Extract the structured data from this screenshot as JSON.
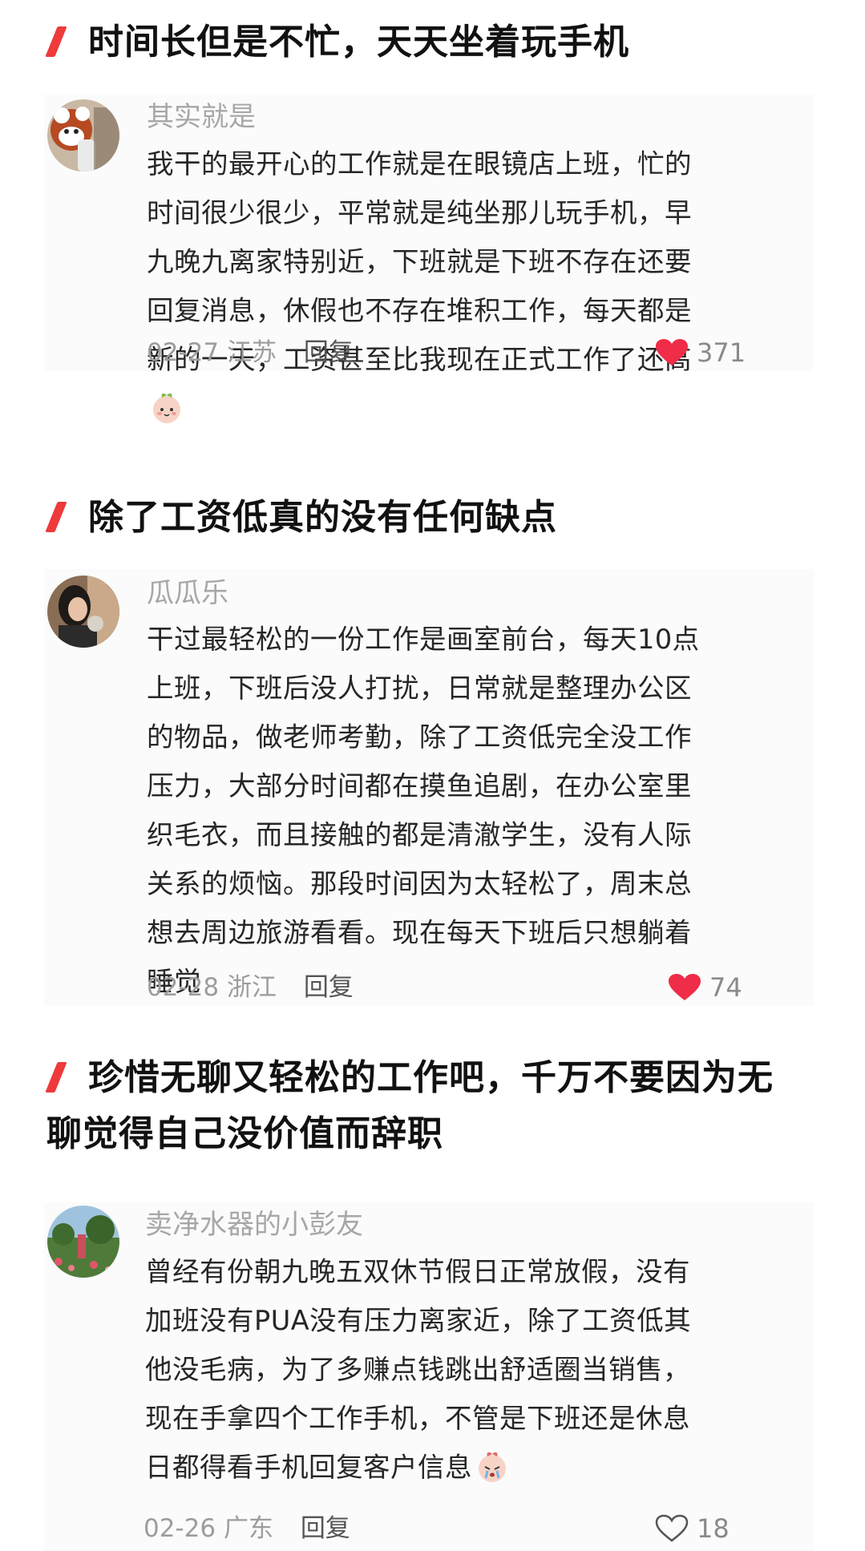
{
  "posts": [
    {
      "heading": "时间长但是不忙，天天坐着玩手机",
      "username": "其实就是",
      "avatar_icon": "red-panda-avatar",
      "comment": "我干的最开心的工作就是在眼镜店上班，忙的时间很少很少，平常就是纯坐那儿玩手机，早九晚九离家特别近，下班就是下班不存在还要回复消息，休假也不存在堆积工作，每天都是新的一天，工资甚至比我现在正式工作了还高",
      "emoji_icon": "peach-face-emoji",
      "date": "02-27",
      "location": "江苏",
      "reply_label": "回复",
      "likes": "371",
      "liked": true
    },
    {
      "heading": "除了工资低真的没有任何缺点",
      "username": "瓜瓜乐",
      "avatar_icon": "girl-eating-avatar",
      "comment": "干过最轻松的一份工作是画室前台，每天10点上班，下班后没人打扰，日常就是整理办公区的物品，做老师考勤，除了工资低完全没工作压力，大部分时间都在摸鱼追剧，在办公室里织毛衣，而且接触的都是清澈学生，没有人际关系的烦恼。那段时间因为太轻松了，周末总想去周边旅游看看。现在每天下班后只想躺着睡觉",
      "date": "02-28",
      "location": "浙江",
      "reply_label": "回复",
      "likes": "74",
      "liked": true
    },
    {
      "heading": "珍惜无聊又轻松的工作吧，千万不要因为无聊觉得自己没价值而辞职",
      "username": "卖净水器的小彭友",
      "avatar_icon": "garden-photo-avatar",
      "comment": "曾经有份朝九晚五双休节假日正常放假，没有加班没有PUA没有压力离家近，除了工资低其他没毛病，为了多赚点钱跳出舒适圈当销售，现在手拿四个工作手机，不管是下班还是休息日都得看手机回复客户信息",
      "emoji_icon": "crying-peach-emoji",
      "date": "02-26",
      "location": "广东",
      "reply_label": "回复",
      "likes": "18",
      "liked": false
    }
  ],
  "colors": {
    "accent": "#ee3a3a",
    "heart_liked": "#ef2d48",
    "username": "#a7a7a7",
    "meta": "#9d9d9d"
  }
}
